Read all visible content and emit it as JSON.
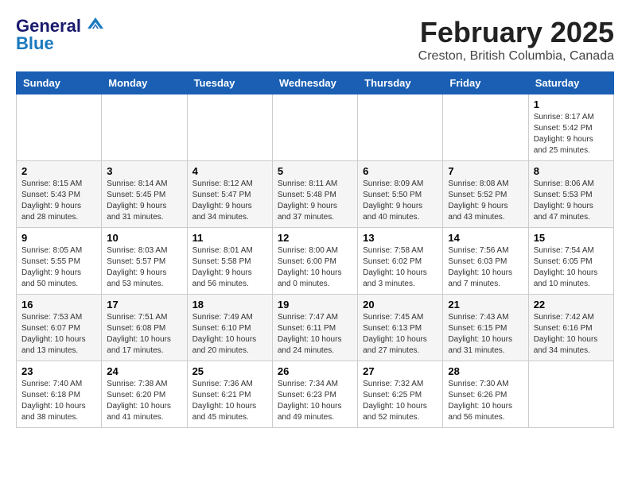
{
  "header": {
    "logo_line1": "General",
    "logo_line2": "Blue",
    "month": "February 2025",
    "location": "Creston, British Columbia, Canada"
  },
  "weekdays": [
    "Sunday",
    "Monday",
    "Tuesday",
    "Wednesday",
    "Thursday",
    "Friday",
    "Saturday"
  ],
  "weeks": [
    [
      {
        "day": "",
        "info": ""
      },
      {
        "day": "",
        "info": ""
      },
      {
        "day": "",
        "info": ""
      },
      {
        "day": "",
        "info": ""
      },
      {
        "day": "",
        "info": ""
      },
      {
        "day": "",
        "info": ""
      },
      {
        "day": "1",
        "info": "Sunrise: 8:17 AM\nSunset: 5:42 PM\nDaylight: 9 hours\nand 25 minutes."
      }
    ],
    [
      {
        "day": "2",
        "info": "Sunrise: 8:15 AM\nSunset: 5:43 PM\nDaylight: 9 hours\nand 28 minutes."
      },
      {
        "day": "3",
        "info": "Sunrise: 8:14 AM\nSunset: 5:45 PM\nDaylight: 9 hours\nand 31 minutes."
      },
      {
        "day": "4",
        "info": "Sunrise: 8:12 AM\nSunset: 5:47 PM\nDaylight: 9 hours\nand 34 minutes."
      },
      {
        "day": "5",
        "info": "Sunrise: 8:11 AM\nSunset: 5:48 PM\nDaylight: 9 hours\nand 37 minutes."
      },
      {
        "day": "6",
        "info": "Sunrise: 8:09 AM\nSunset: 5:50 PM\nDaylight: 9 hours\nand 40 minutes."
      },
      {
        "day": "7",
        "info": "Sunrise: 8:08 AM\nSunset: 5:52 PM\nDaylight: 9 hours\nand 43 minutes."
      },
      {
        "day": "8",
        "info": "Sunrise: 8:06 AM\nSunset: 5:53 PM\nDaylight: 9 hours\nand 47 minutes."
      }
    ],
    [
      {
        "day": "9",
        "info": "Sunrise: 8:05 AM\nSunset: 5:55 PM\nDaylight: 9 hours\nand 50 minutes."
      },
      {
        "day": "10",
        "info": "Sunrise: 8:03 AM\nSunset: 5:57 PM\nDaylight: 9 hours\nand 53 minutes."
      },
      {
        "day": "11",
        "info": "Sunrise: 8:01 AM\nSunset: 5:58 PM\nDaylight: 9 hours\nand 56 minutes."
      },
      {
        "day": "12",
        "info": "Sunrise: 8:00 AM\nSunset: 6:00 PM\nDaylight: 10 hours\nand 0 minutes."
      },
      {
        "day": "13",
        "info": "Sunrise: 7:58 AM\nSunset: 6:02 PM\nDaylight: 10 hours\nand 3 minutes."
      },
      {
        "day": "14",
        "info": "Sunrise: 7:56 AM\nSunset: 6:03 PM\nDaylight: 10 hours\nand 7 minutes."
      },
      {
        "day": "15",
        "info": "Sunrise: 7:54 AM\nSunset: 6:05 PM\nDaylight: 10 hours\nand 10 minutes."
      }
    ],
    [
      {
        "day": "16",
        "info": "Sunrise: 7:53 AM\nSunset: 6:07 PM\nDaylight: 10 hours\nand 13 minutes."
      },
      {
        "day": "17",
        "info": "Sunrise: 7:51 AM\nSunset: 6:08 PM\nDaylight: 10 hours\nand 17 minutes."
      },
      {
        "day": "18",
        "info": "Sunrise: 7:49 AM\nSunset: 6:10 PM\nDaylight: 10 hours\nand 20 minutes."
      },
      {
        "day": "19",
        "info": "Sunrise: 7:47 AM\nSunset: 6:11 PM\nDaylight: 10 hours\nand 24 minutes."
      },
      {
        "day": "20",
        "info": "Sunrise: 7:45 AM\nSunset: 6:13 PM\nDaylight: 10 hours\nand 27 minutes."
      },
      {
        "day": "21",
        "info": "Sunrise: 7:43 AM\nSunset: 6:15 PM\nDaylight: 10 hours\nand 31 minutes."
      },
      {
        "day": "22",
        "info": "Sunrise: 7:42 AM\nSunset: 6:16 PM\nDaylight: 10 hours\nand 34 minutes."
      }
    ],
    [
      {
        "day": "23",
        "info": "Sunrise: 7:40 AM\nSunset: 6:18 PM\nDaylight: 10 hours\nand 38 minutes."
      },
      {
        "day": "24",
        "info": "Sunrise: 7:38 AM\nSunset: 6:20 PM\nDaylight: 10 hours\nand 41 minutes."
      },
      {
        "day": "25",
        "info": "Sunrise: 7:36 AM\nSunset: 6:21 PM\nDaylight: 10 hours\nand 45 minutes."
      },
      {
        "day": "26",
        "info": "Sunrise: 7:34 AM\nSunset: 6:23 PM\nDaylight: 10 hours\nand 49 minutes."
      },
      {
        "day": "27",
        "info": "Sunrise: 7:32 AM\nSunset: 6:25 PM\nDaylight: 10 hours\nand 52 minutes."
      },
      {
        "day": "28",
        "info": "Sunrise: 7:30 AM\nSunset: 6:26 PM\nDaylight: 10 hours\nand 56 minutes."
      },
      {
        "day": "",
        "info": ""
      }
    ]
  ]
}
